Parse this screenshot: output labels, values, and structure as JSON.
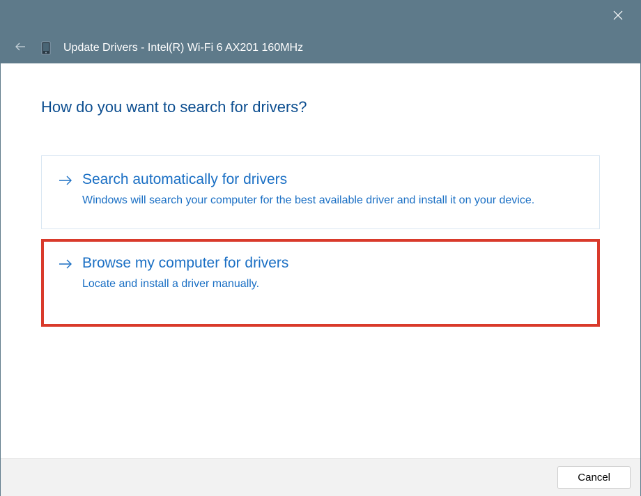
{
  "header": {
    "title": "Update Drivers - Intel(R) Wi-Fi 6 AX201 160MHz"
  },
  "main": {
    "question": "How do you want to search for drivers?",
    "options": [
      {
        "title": "Search automatically for drivers",
        "description": "Windows will search your computer for the best available driver and install it on your device."
      },
      {
        "title": "Browse my computer for drivers",
        "description": "Locate and install a driver manually."
      }
    ]
  },
  "footer": {
    "cancel_label": "Cancel"
  }
}
